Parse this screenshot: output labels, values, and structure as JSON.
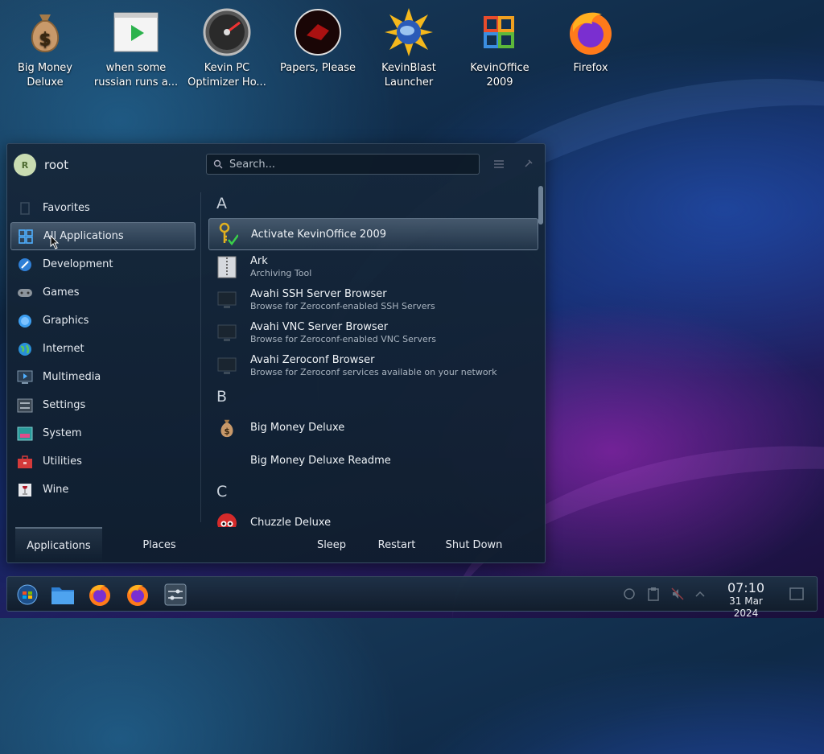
{
  "desktop": {
    "icons": [
      {
        "label": "Big Money Deluxe",
        "icon": "money-bag-icon"
      },
      {
        "label": "when some russian runs a...",
        "icon": "video-play-icon"
      },
      {
        "label": "Kevin PC Optimizer Ho...",
        "icon": "speedometer-icon"
      },
      {
        "label": "Papers, Please",
        "icon": "papers-please-icon"
      },
      {
        "label": "KevinBlast Launcher",
        "icon": "sun-globe-icon"
      },
      {
        "label": "KevinOffice 2009",
        "icon": "office-icon"
      },
      {
        "label": "Firefox",
        "icon": "firefox-icon"
      }
    ]
  },
  "launcher": {
    "user": {
      "name": "root",
      "avatar_letter": "R"
    },
    "search": {
      "placeholder": "Search..."
    },
    "categories": [
      {
        "label": "Favorites",
        "icon": "favorites-icon"
      },
      {
        "label": "All Applications",
        "icon": "grid-icon",
        "active": true
      },
      {
        "label": "Development",
        "icon": "development-icon"
      },
      {
        "label": "Games",
        "icon": "gamepad-icon"
      },
      {
        "label": "Graphics",
        "icon": "graphics-icon"
      },
      {
        "label": "Internet",
        "icon": "globe-icon"
      },
      {
        "label": "Multimedia",
        "icon": "multimedia-icon"
      },
      {
        "label": "Settings",
        "icon": "settings-icon"
      },
      {
        "label": "System",
        "icon": "system-icon"
      },
      {
        "label": "Utilities",
        "icon": "toolbox-icon"
      },
      {
        "label": "Wine",
        "icon": "wine-icon"
      }
    ],
    "sections": [
      {
        "letter": "A",
        "apps": [
          {
            "name": "Activate KevinOffice 2009",
            "desc": "",
            "icon": "key-check-icon",
            "highlighted": true
          },
          {
            "name": "Ark",
            "desc": "Archiving Tool",
            "icon": "archive-icon"
          },
          {
            "name": "Avahi SSH Server Browser",
            "desc": "Browse for Zeroconf-enabled SSH Servers",
            "icon": "monitor-icon"
          },
          {
            "name": "Avahi VNC Server Browser",
            "desc": "Browse for Zeroconf-enabled VNC Servers",
            "icon": "monitor-icon"
          },
          {
            "name": "Avahi Zeroconf Browser",
            "desc": "Browse for Zeroconf services available on your network",
            "icon": "monitor-icon"
          }
        ]
      },
      {
        "letter": "B",
        "apps": [
          {
            "name": "Big Money Deluxe",
            "desc": "",
            "icon": "money-bag-icon"
          },
          {
            "name": "Big Money Deluxe Readme",
            "desc": "",
            "icon": ""
          }
        ]
      },
      {
        "letter": "C",
        "apps": [
          {
            "name": "Chuzzle Deluxe",
            "desc": "",
            "icon": "chuzzle-icon"
          }
        ]
      }
    ],
    "footer": {
      "applications": "Applications",
      "places": "Places",
      "sleep": "Sleep",
      "restart": "Restart",
      "shutdown": "Shut Down"
    }
  },
  "taskbar": {
    "clock": {
      "time": "07:10",
      "date": "31 Mar 2024"
    }
  }
}
